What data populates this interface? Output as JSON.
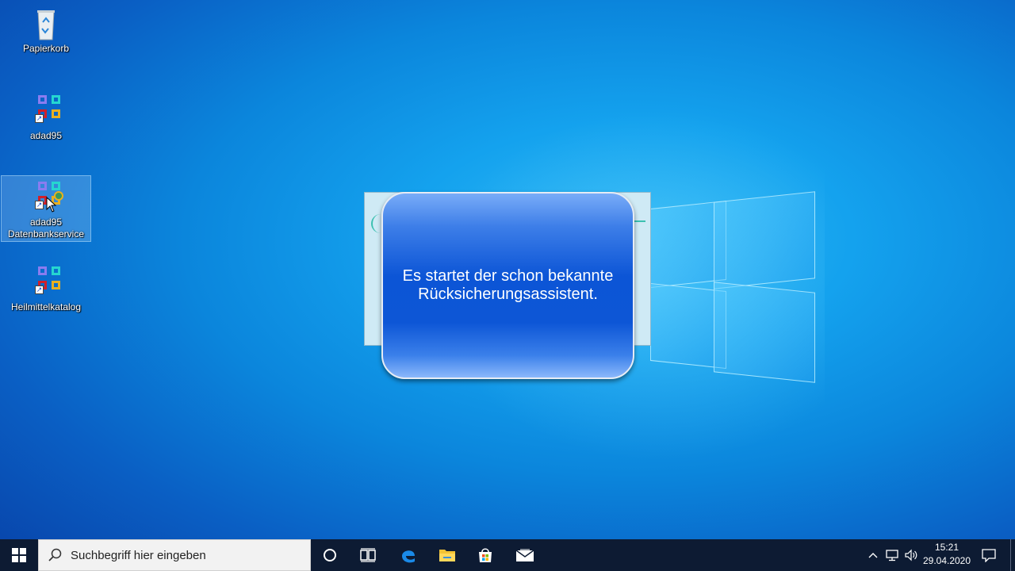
{
  "desktop": {
    "icons": [
      {
        "label": "Papierkorb",
        "icon": "recycle-bin-icon"
      },
      {
        "label": "adad95",
        "icon": "adad95-app-icon"
      },
      {
        "label": "adad95 Datenbankservice",
        "icon": "adad95-database-service-icon"
      },
      {
        "label": "Heilmittelkatalog",
        "icon": "heilmittelkatalog-icon"
      }
    ]
  },
  "callout": {
    "text": "Es startet der schon bekannte Rücksicherungsassistent."
  },
  "taskbar": {
    "search_placeholder": "Suchbegriff hier eingeben",
    "pinned": [
      "cortana-icon",
      "task-view-icon",
      "edge-icon",
      "file-explorer-icon",
      "store-icon",
      "mail-icon"
    ],
    "tray": [
      "chevron-up-icon",
      "network-icon",
      "volume-icon"
    ],
    "time": "15:21",
    "date": "29.04.2020"
  },
  "colors": {
    "taskbar": "#0d1b33",
    "callout_blue": "#0c55d6",
    "desktop_blue": "#14a2ee"
  }
}
